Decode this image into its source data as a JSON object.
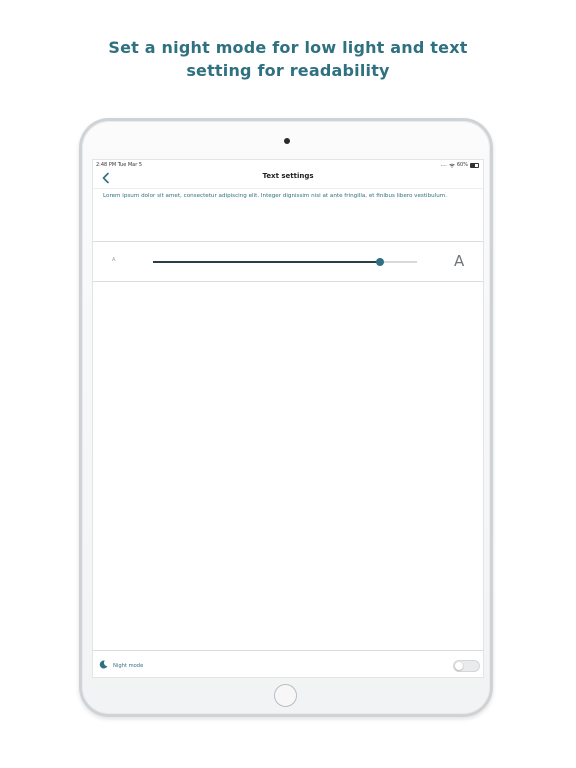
{
  "headline": {
    "line1": "Set a night mode for low light and text",
    "line2": "setting for readability",
    "color": "#2f7180"
  },
  "statusbar": {
    "time": "2:48 PM  Tue Mar 5",
    "signal": "....",
    "wifi": "wifi-icon",
    "battery_text": "60%"
  },
  "navbar": {
    "back_icon": "chevron-left-icon",
    "title": "Text settings"
  },
  "preview": {
    "text": "Lorem ipsum dolor sit amet, consectetur adipiscing elit. Integer dignissim nisi at ante fringilla, et finibus libero vestibulum."
  },
  "text_size": {
    "small_label": "A",
    "large_label": "A",
    "value_fraction": 0.86
  },
  "night_mode": {
    "icon": "moon-icon",
    "label": "Night mode",
    "enabled": false
  }
}
